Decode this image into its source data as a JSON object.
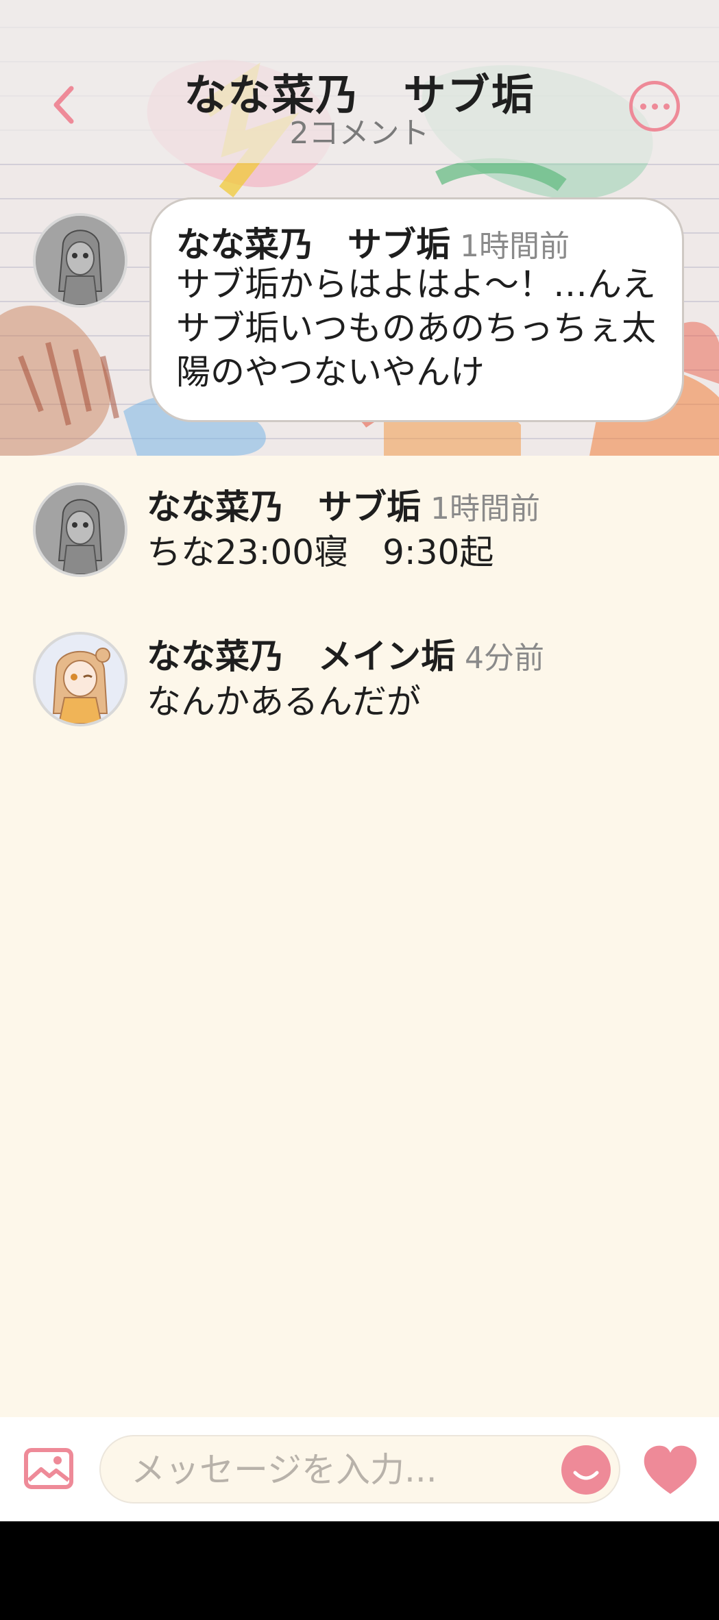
{
  "header": {
    "title": "なな菜乃　サブ垢",
    "subtitle": "2コメント"
  },
  "post": {
    "author": "なな菜乃　サブ垢",
    "time": "1時間前",
    "text": "サブ垢からはよはよ〜！…んえサブ垢いつものあのちっちぇ太陽のやつないやんけ"
  },
  "comments": [
    {
      "author": "なな菜乃　サブ垢",
      "time": "1時間前",
      "text": "ちな23:00寝　9:30起"
    },
    {
      "author": "なな菜乃　メイン垢",
      "time": "4分前",
      "text": "なんかあるんだが"
    }
  ],
  "composer": {
    "placeholder": "メッセージを入力..."
  },
  "colors": {
    "accent": "#ee8a98",
    "background": "#fdf7ea"
  },
  "icons": {
    "back": "chevron-left-icon",
    "more": "more-dots-icon",
    "image": "image-icon",
    "emoji": "emoji-icon",
    "like": "heart-icon"
  }
}
